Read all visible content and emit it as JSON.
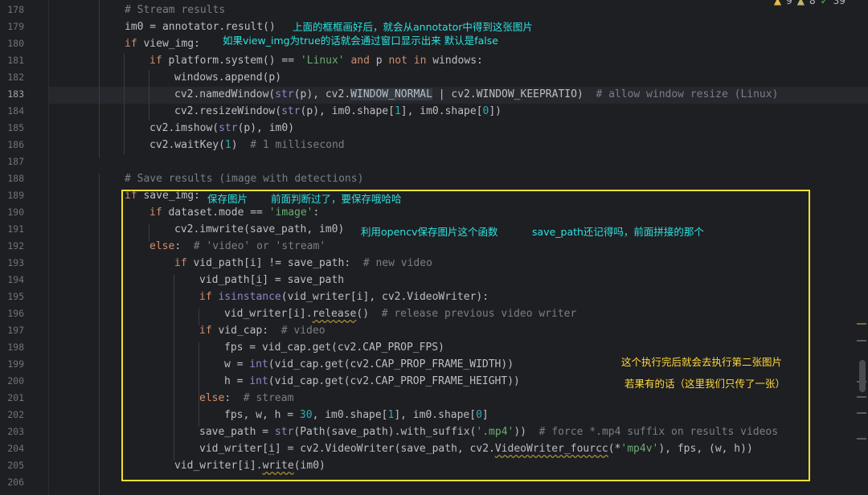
{
  "inspection": {
    "warnings": "9",
    "weak_warnings": "8",
    "typos": "39",
    "chevron": "^"
  },
  "line_numbers": [
    "178",
    "179",
    "180",
    "181",
    "182",
    "183",
    "184",
    "185",
    "186",
    "187",
    "188",
    "189",
    "190",
    "191",
    "192",
    "193",
    "194",
    "195",
    "196",
    "197",
    "198",
    "199",
    "200",
    "201",
    "202",
    "203",
    "204",
    "205",
    "206"
  ],
  "current_line": "183",
  "annotations": {
    "a179": "上面的框框画好后，就会从annotator中得到这张图片",
    "a180": "如果view_img为true的话就会通过窗口显示出来  默认是false",
    "a189a": "保存图片",
    "a189b": "前面判断过了，要保存哦哈哈",
    "a191a": "利用opencv保存图片这个函数",
    "a191b": "save_path还记得吗，前面拼接的那个",
    "a198": "这个执行完后就会去执行第二张图片",
    "a200": "若果有的话（这里我们只传了一张）"
  },
  "code": {
    "l178": [
      "# Stream results"
    ],
    "l179": [
      "im0 = annotator.result()"
    ],
    "l180": [
      "if",
      " view_img:"
    ],
    "l181": [
      "if",
      " platform.system() == ",
      "'Linux'",
      " ",
      "and",
      " p ",
      "not in",
      " windows:"
    ],
    "l182": [
      "windows.append(p)"
    ],
    "l183": [
      "cv2.namedWindow(",
      "str",
      "(p), cv2.",
      "WINDOW_NORMAL",
      " | cv2.",
      "WINDOW_KEEPRATIO",
      ")  ",
      "# allow window resize (Linux)"
    ],
    "l184": [
      "cv2.resizeWindow(",
      "str",
      "(p), im0.shape[",
      "1",
      "], im0.shape[",
      "0",
      "])"
    ],
    "l185": [
      "cv2.imshow(",
      "str",
      "(p), im0)"
    ],
    "l186": [
      "cv2.waitKey(",
      "1",
      ")  ",
      "# 1 millisecond"
    ],
    "l188": [
      "# Save results (image with detections)"
    ],
    "l189": [
      "if",
      " save_img:"
    ],
    "l190": [
      "if",
      " dataset.mode == ",
      "'image'",
      ":"
    ],
    "l191": [
      "cv2.imwrite(save_path, im0)"
    ],
    "l192": [
      "else",
      ":  ",
      "# 'video' or 'stream'"
    ],
    "l193": [
      "if",
      " vid_path[i] != save_path:  ",
      "# new video"
    ],
    "l194": [
      "vid_path[",
      "i",
      "] = save_path"
    ],
    "l195": [
      "if",
      " ",
      "isinstance",
      "(vid_writer[i], cv2.VideoWriter):"
    ],
    "l196": [
      "vid_writer[i].",
      "release",
      "()  ",
      "# release previous video writer"
    ],
    "l197": [
      "if",
      " vid_cap:  ",
      "# video"
    ],
    "l198": [
      "fps = vid_cap.get(cv2.CAP_PROP_FPS)"
    ],
    "l199": [
      "w = ",
      "int",
      "(vid_cap.get(cv2.CAP_PROP_FRAME_WIDTH))"
    ],
    "l200": [
      "h = ",
      "int",
      "(vid_cap.get(cv2.CAP_PROP_FRAME_HEIGHT))"
    ],
    "l201": [
      "else",
      ":  ",
      "# stream"
    ],
    "l202": [
      "fps, w, h = ",
      "30",
      ", im0.shape[",
      "1",
      "], im0.shape[",
      "0",
      "]"
    ],
    "l203": [
      "save_path = ",
      "str",
      "(Path(save_path).with_suffix(",
      "'.mp4'",
      "))  ",
      "# force *.mp4 suffix on results videos"
    ],
    "l204": [
      "vid_writer[",
      "i",
      "] = cv2.VideoWriter(save_path, cv2.",
      "VideoWriter_fourcc",
      "(*",
      "'mp4v'",
      "), fps, (w, h))"
    ],
    "l205": [
      "vid_writer[i].",
      "write",
      "(im0)"
    ]
  },
  "colors": {
    "background": "#1e1f22",
    "keyword": "#cf8e6d",
    "string": "#6aab73",
    "number": "#2aacb8",
    "comment": "#7a7e85",
    "annotation_cyan": "#2ee0e0",
    "annotation_yellow": "#ffd83a",
    "highlight_box": "#f2e02c"
  }
}
